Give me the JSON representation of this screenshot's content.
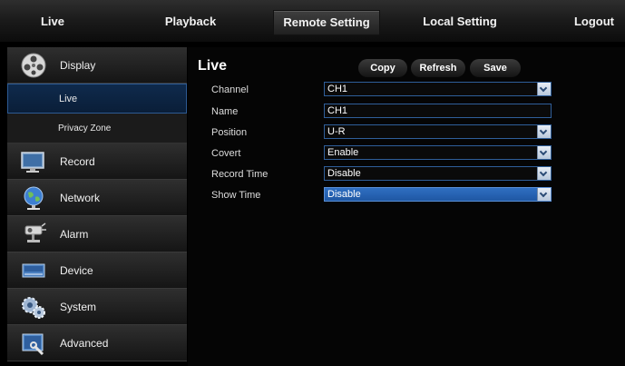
{
  "nav": {
    "tabs": [
      {
        "label": "Live"
      },
      {
        "label": "Playback"
      },
      {
        "label": "Remote Setting"
      },
      {
        "label": "Local Setting"
      },
      {
        "label": "Logout"
      }
    ]
  },
  "sidebar": {
    "display": "Display",
    "live": "Live",
    "privacy_zone": "Privacy Zone",
    "record": "Record",
    "network": "Network",
    "alarm": "Alarm",
    "device": "Device",
    "system": "System",
    "advanced": "Advanced"
  },
  "main": {
    "title": "Live",
    "buttons": {
      "copy": "Copy",
      "refresh": "Refresh",
      "save": "Save"
    },
    "fields": {
      "channel": {
        "label": "Channel",
        "value": "CH1"
      },
      "name": {
        "label": "Name",
        "value": "CH1"
      },
      "position": {
        "label": "Position",
        "value": "U-R"
      },
      "covert": {
        "label": "Covert",
        "value": "Enable"
      },
      "record_time": {
        "label": "Record Time",
        "value": "Disable"
      },
      "show_time": {
        "label": "Show Time",
        "value": "Disable"
      }
    }
  },
  "colors": {
    "selection": "#0f2a4c",
    "field_border": "#2f5f9a",
    "highlight": "#2f6fc2"
  }
}
